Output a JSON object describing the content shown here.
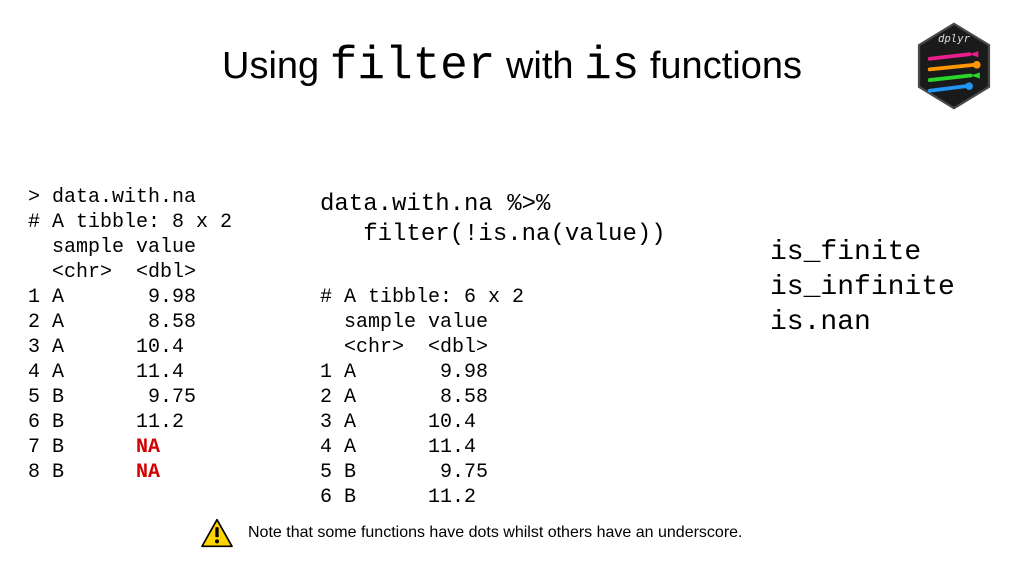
{
  "title": {
    "p1": "Using ",
    "p2": "filter",
    "p3": " with ",
    "p4": "is",
    "p5": " functions"
  },
  "left": {
    "l0": "> data.with.na",
    "l1": "# A tibble: 8 x 2",
    "l2": "  sample value",
    "l3": "  <chr>  <dbl>",
    "r1": "1 A       9.98",
    "r2": "2 A       8.58",
    "r3": "3 A      10.4 ",
    "r4": "4 A      11.4 ",
    "r5": "5 B       9.75",
    "r6": "6 B      11.2 ",
    "r7a": "7 B      ",
    "r7b": "NA",
    "r8a": "8 B      ",
    "r8b": "NA"
  },
  "mid": {
    "c1": "data.with.na %>%",
    "c2": "   filter(!is.na(value))"
  },
  "mid2": {
    "l0": "# A tibble: 6 x 2",
    "l1": "  sample value",
    "l2": "  <chr>  <dbl>",
    "r1": "1 A       9.98",
    "r2": "2 A       8.58",
    "r3": "3 A      10.4 ",
    "r4": "4 A      11.4 ",
    "r5": "5 B       9.75",
    "r6": "6 B      11.2 "
  },
  "right": {
    "f1": "is_finite",
    "f2": "is_infinite",
    "f3": "is.nan"
  },
  "note": "Note that some functions have dots whilst others have an underscore."
}
